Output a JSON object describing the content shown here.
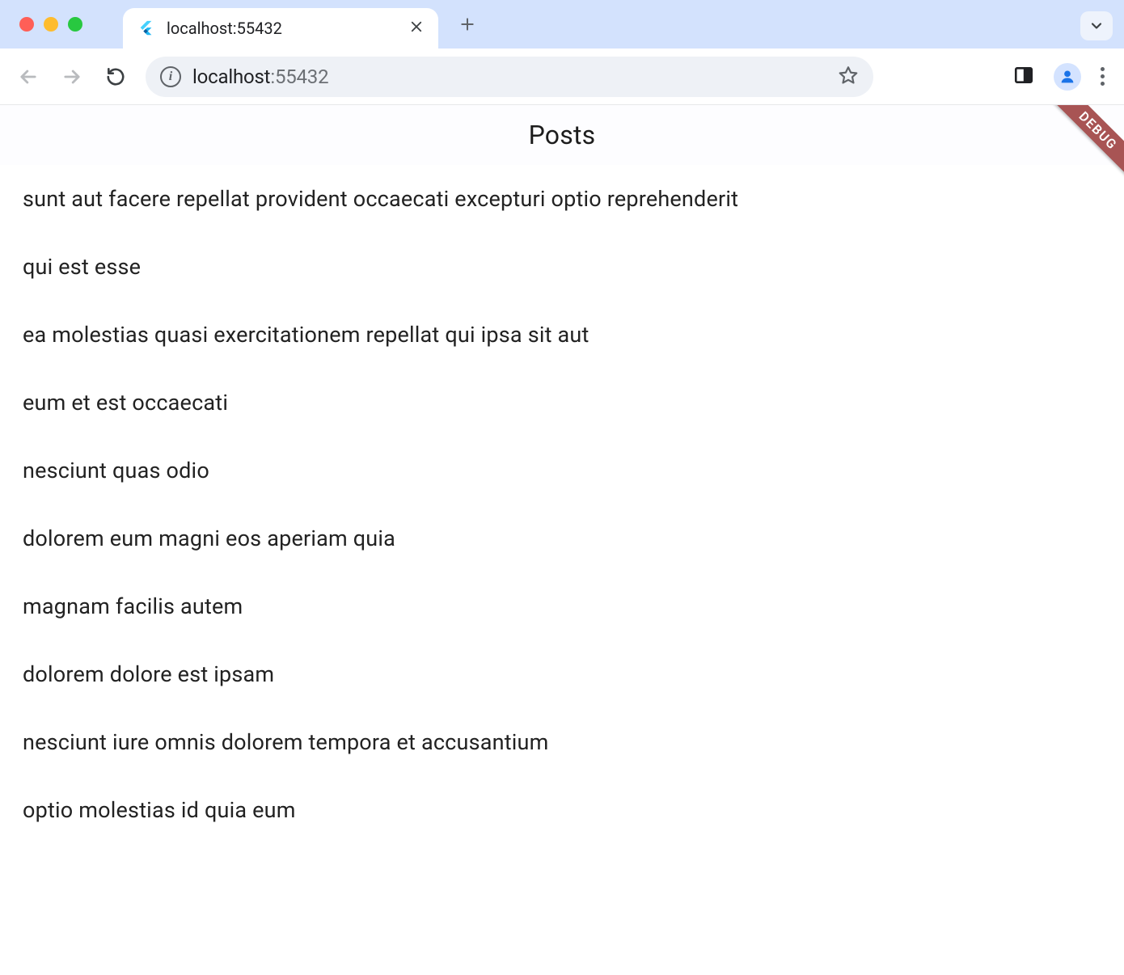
{
  "browser": {
    "tab": {
      "title": "localhost:55432"
    },
    "omnibox": {
      "host": "localhost",
      "port": ":55432"
    }
  },
  "app": {
    "title": "Posts",
    "debug_label": "DEBUG",
    "posts": [
      "sunt aut facere repellat provident occaecati excepturi optio reprehenderit",
      "qui est esse",
      "ea molestias quasi exercitationem repellat qui ipsa sit aut",
      "eum et est occaecati",
      "nesciunt quas odio",
      "dolorem eum magni eos aperiam quia",
      "magnam facilis autem",
      "dolorem dolore est ipsam",
      "nesciunt iure omnis dolorem tempora et accusantium",
      "optio molestias id quia eum"
    ]
  }
}
